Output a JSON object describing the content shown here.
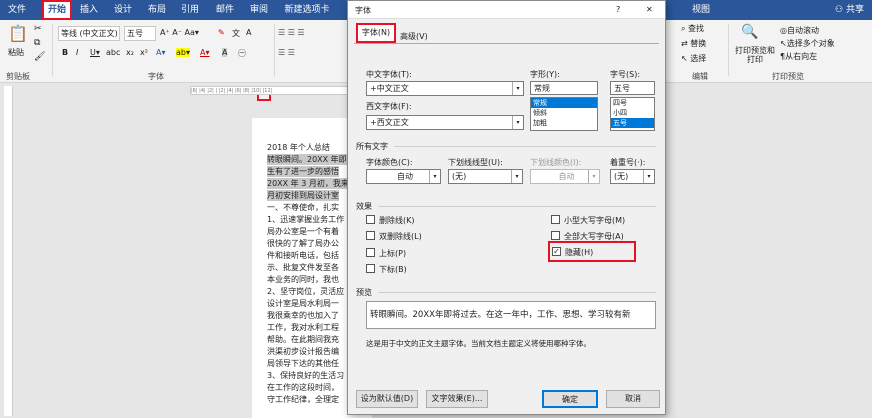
{
  "tabs": [
    "文件",
    "开始",
    "插入",
    "设计",
    "布局",
    "引用",
    "邮件",
    "审阅",
    "新建选项卡",
    "视图"
  ],
  "share": "共享",
  "ribbon": {
    "paste": "粘贴",
    "clipboard": "剪贴板",
    "font_name": "等线 (中文正文)",
    "font_size": "五号",
    "font_group": "字体",
    "editing": {
      "find": "查找",
      "replace": "替换",
      "select": "选择",
      "label": "编辑"
    },
    "print_preview": "打印预览和打印",
    "preview_opts": [
      "自动滚动",
      "选择多个对象",
      "从右向左"
    ],
    "preview_label": "打印预览"
  },
  "doc": {
    "lines": [
      "2018 年个人总结",
      "转眼瞬间。20XX 年即",
      "生有了进一步的感悟",
      "20XX 年 3 月初，我来",
      "月初安排到局设计室",
      "一、不尊使命，扎实",
      "1、迅速掌握业务工作",
      "局办公室是一个有着",
      "很快的了解了局办公",
      "件和接听电话，包括",
      "示、批复文件发至各",
      "本业务的同时，我也",
      "2、坚守岗位，灵活应",
      "设计室是局水利局一",
      "我很乘幸的也加入了",
      "工作，我对水利工程",
      "帮助。在此期间我充",
      "洪渠初步设计报告编",
      "局领导下达的其他任",
      "3、保持良好的生活习",
      "在工作的这段时间，",
      "守工作纪律，全理定"
    ]
  },
  "dialog": {
    "title": "字体",
    "help": "?",
    "close": "✕",
    "tab_font": "字体(N)",
    "tab_adv": "高级(V)",
    "cn_font_label": "中文字体(T):",
    "cn_font": "+中文正文",
    "west_font_label": "西文字体(F):",
    "west_font": "+西文正文",
    "style_label": "字形(Y):",
    "style_value": "常规",
    "styles": [
      "常规",
      "倾斜",
      "加粗"
    ],
    "size_label": "字号(S):",
    "size_value": "五号",
    "sizes": [
      "四号",
      "小四",
      "五号"
    ],
    "all_text": "所有文字",
    "color_label": "字体颜色(C):",
    "color_value": "自动",
    "underline_label": "下划线线型(U):",
    "underline_value": "(无)",
    "ucolor_label": "下划线颜色(I):",
    "ucolor_value": "自动",
    "emph_label": "着重号(·):",
    "emph_value": "(无)",
    "effects": "效果",
    "eff_left": [
      "删除线(K)",
      "双删除线(L)",
      "上标(P)",
      "下标(B)"
    ],
    "eff_right": [
      "小型大写字母(M)",
      "全部大写字母(A)",
      "隐藏(H)"
    ],
    "preview_label": "预览",
    "preview_text": "转眼瞬间。20XX年即将过去。在这一年中，工作、思想、学习较有新",
    "note": "这是用于中文的正文主题字体。当前文档主题定义将使用哪种字体。",
    "btn_default": "设为默认值(D)",
    "btn_effects": "文字效果(E)...",
    "btn_ok": "确定",
    "btn_cancel": "取消"
  },
  "colors": {
    "accent": "#2b579a",
    "highlight": "#e81123",
    "select": "#0078d7"
  }
}
